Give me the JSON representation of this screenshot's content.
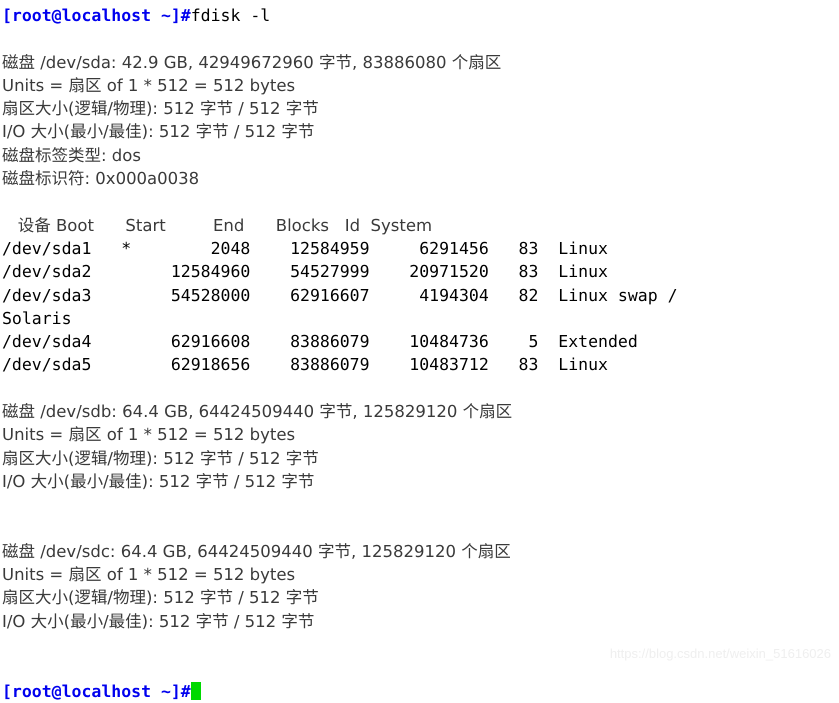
{
  "terminal": {
    "background_color": "#ffffff",
    "foreground_color": "#000000",
    "prompt_color": "#0000ee",
    "cjk_color": "#3a3a3a",
    "cursor_color": "#00d900",
    "prompt_text": "[root@localhost ~]#",
    "command": "fdisk -l"
  },
  "disks": {
    "sda": {
      "summary": "磁盘 /dev/sda: 42.9 GB, 42949672960 字节, 83886080 个扇区",
      "units": "Units = 扇区 of 1 * 512 = 512 bytes",
      "sector_size": "扇区大小(逻辑/物理): 512 字节 / 512 字节",
      "io_size": "I/O 大小(最小/最佳): 512 字节 / 512 字节",
      "label_type": "磁盘标签类型: dos",
      "identifier": "磁盘标识符: 0x000a0038"
    },
    "sdb": {
      "summary": "磁盘 /dev/sdb: 64.4 GB, 64424509440 字节, 125829120 个扇区",
      "units": "Units = 扇区 of 1 * 512 = 512 bytes",
      "sector_size": "扇区大小(逻辑/物理): 512 字节 / 512 字节",
      "io_size": "I/O 大小(最小/最佳): 512 字节 / 512 字节"
    },
    "sdc": {
      "summary": "磁盘 /dev/sdc: 64.4 GB, 64424509440 字节, 125829120 个扇区",
      "units": "Units = 扇区 of 1 * 512 = 512 bytes",
      "sector_size": "扇区大小(逻辑/物理): 512 字节 / 512 字节",
      "io_size": "I/O 大小(最小/最佳): 512 字节 / 512 字节"
    }
  },
  "partition_table": {
    "header": "   设备 Boot      Start         End      Blocks   Id  System",
    "rows": [
      "/dev/sda1   *        2048    12584959     6291456   83  Linux",
      "/dev/sda2        12584960    54527999    20971520   83  Linux",
      "/dev/sda3        54528000    62916607     4194304   82  Linux swap /",
      "Solaris",
      "/dev/sda4        62916608    83886079    10484736    5  Extended",
      "/dev/sda5        62918656    83886079    10483712   83  Linux"
    ]
  },
  "watermark": {
    "text": "https://blog.csdn.net/weixin_51616026"
  }
}
